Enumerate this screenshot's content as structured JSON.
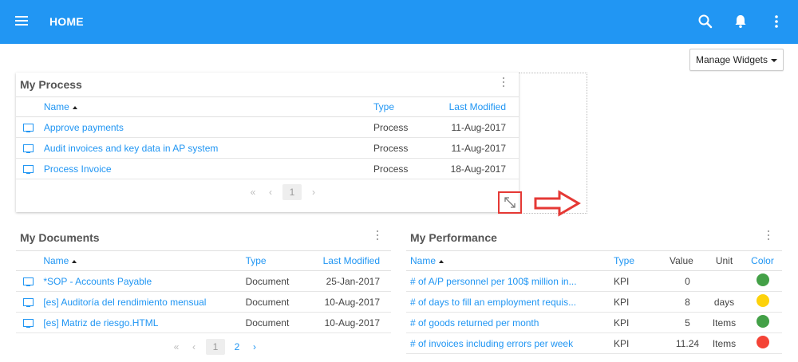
{
  "header": {
    "title": "HOME",
    "icons": [
      "menu-icon",
      "search-icon",
      "bell-icon",
      "more-vert-icon"
    ]
  },
  "toolbar": {
    "manage_widgets": "Manage Widgets"
  },
  "process": {
    "title": "My Process",
    "columns": [
      "Name",
      "Type",
      "Last Modified"
    ],
    "rows": [
      {
        "name": "Approve payments",
        "type": "Process",
        "modified": "11-Aug-2017"
      },
      {
        "name": "Audit invoices and key data in AP system",
        "type": "Process",
        "modified": "11-Aug-2017"
      },
      {
        "name": "Process Invoice",
        "type": "Process",
        "modified": "18-Aug-2017"
      }
    ],
    "pager": {
      "first": "«",
      "prev": "‹",
      "current": "1",
      "next": "›"
    }
  },
  "documents": {
    "title": "My Documents",
    "columns": [
      "Name",
      "Type",
      "Last Modified"
    ],
    "rows": [
      {
        "name": "*SOP - Accounts Payable",
        "type": "Document",
        "modified": "25-Jan-2017"
      },
      {
        "name": "[es] Auditoría del rendimiento mensual",
        "type": "Document",
        "modified": "10-Aug-2017"
      },
      {
        "name": "[es] Matriz de riesgo.HTML",
        "type": "Document",
        "modified": "10-Aug-2017"
      }
    ],
    "pager": {
      "first": "«",
      "prev": "‹",
      "current": "1",
      "page2": "2",
      "next": "›"
    }
  },
  "performance": {
    "title": "My Performance",
    "columns": [
      "Name",
      "Type",
      "Value",
      "Unit",
      "Color"
    ],
    "rows": [
      {
        "name": "# of A/P personnel per 100$ million in...",
        "type": "KPI",
        "value": "0",
        "unit": "",
        "color": "#43a047"
      },
      {
        "name": "# of days to fill an employment requis...",
        "type": "KPI",
        "value": "8",
        "unit": "days",
        "color": "#fdd20a"
      },
      {
        "name": "# of goods returned per month",
        "type": "KPI",
        "value": "5",
        "unit": "Items",
        "color": "#43a047"
      },
      {
        "name": "# of invoices including errors per week",
        "type": "KPI",
        "value": "11.24",
        "unit": "Items",
        "color": "#f44336"
      }
    ]
  },
  "colors": {
    "primary": "#2196f3",
    "highlight": "#e53935"
  }
}
